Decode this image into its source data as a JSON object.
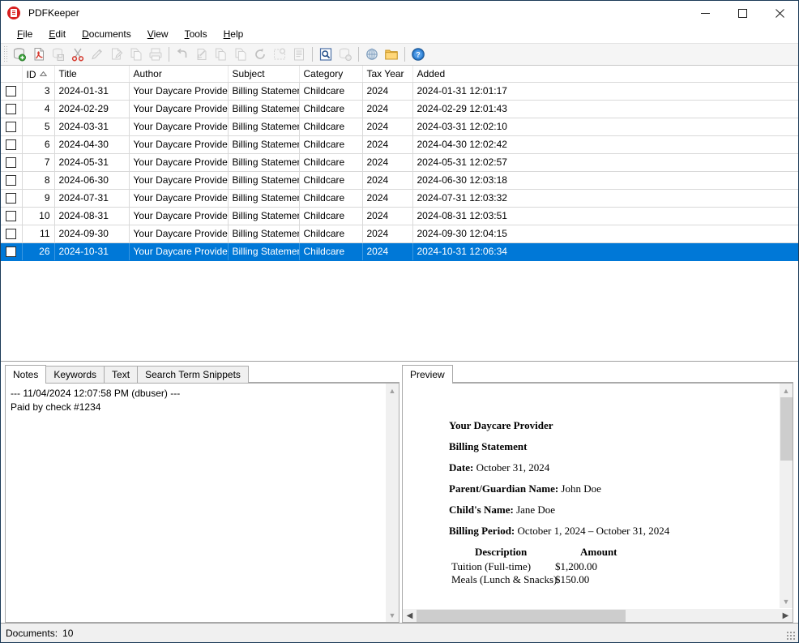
{
  "window": {
    "title": "PDFKeeper",
    "icon": "pdf-document-icon",
    "minimize_label": "Minimize",
    "maximize_label": "Maximize",
    "close_label": "Close"
  },
  "menubar": {
    "items": [
      {
        "label": "File",
        "mnemonic": "F"
      },
      {
        "label": "Edit",
        "mnemonic": "E"
      },
      {
        "label": "Documents",
        "mnemonic": "D"
      },
      {
        "label": "View",
        "mnemonic": "V"
      },
      {
        "label": "Tools",
        "mnemonic": "T"
      },
      {
        "label": "Help",
        "mnemonic": "H"
      }
    ]
  },
  "toolbar": {
    "buttons": [
      {
        "name": "add-document-button",
        "icon": "database-add-icon",
        "enabled": true
      },
      {
        "name": "open-pdf-button",
        "icon": "pdf-file-icon",
        "enabled": true
      },
      {
        "name": "save-document-button",
        "icon": "database-save-icon",
        "enabled": false
      },
      {
        "name": "cut-button",
        "icon": "scissors-icon",
        "enabled": true
      },
      {
        "name": "edit-button",
        "icon": "pencil-icon",
        "enabled": false
      },
      {
        "name": "notes-button",
        "icon": "note-edit-icon",
        "enabled": false
      },
      {
        "name": "copy-button",
        "icon": "copy-icon",
        "enabled": false
      },
      {
        "name": "print-button",
        "icon": "printer-icon",
        "enabled": false
      },
      {
        "name": "separator-1",
        "icon": "separator",
        "enabled": false
      },
      {
        "name": "undo-button",
        "icon": "undo-arrow-icon",
        "enabled": false
      },
      {
        "name": "redo-button",
        "icon": "redo-page-icon",
        "enabled": false
      },
      {
        "name": "duplicate-button",
        "icon": "pages-icon",
        "enabled": false
      },
      {
        "name": "paste-button",
        "icon": "page-copy-icon",
        "enabled": false
      },
      {
        "name": "refresh-button",
        "icon": "circular-arrow-icon",
        "enabled": false
      },
      {
        "name": "new-window-button",
        "icon": "window-add-icon",
        "enabled": false
      },
      {
        "name": "text-view-button",
        "icon": "text-page-icon",
        "enabled": false
      },
      {
        "name": "separator-2",
        "icon": "separator",
        "enabled": false
      },
      {
        "name": "search-button",
        "icon": "magnifier-page-icon",
        "enabled": true
      },
      {
        "name": "delete-database-button",
        "icon": "database-delete-icon",
        "enabled": false
      },
      {
        "name": "separator-3",
        "icon": "separator",
        "enabled": false
      },
      {
        "name": "settings-button",
        "icon": "gear-globe-icon",
        "enabled": true
      },
      {
        "name": "open-folder-button",
        "icon": "folder-icon",
        "enabled": true
      },
      {
        "name": "separator-4",
        "icon": "separator",
        "enabled": false
      },
      {
        "name": "help-button",
        "icon": "help-question-icon",
        "enabled": true
      }
    ]
  },
  "documents": {
    "columns": [
      "",
      "ID",
      "Title",
      "Author",
      "Subject",
      "Category",
      "Tax Year",
      "Added"
    ],
    "sort_column": "ID",
    "sort_direction": "ascending",
    "rows": [
      {
        "checked": false,
        "id": "3",
        "title": "2024-01-31",
        "author": "Your Daycare Provider",
        "subject": "Billing Statement",
        "category": "Childcare",
        "tax_year": "2024",
        "added": "2024-01-31 12:01:17",
        "selected": false
      },
      {
        "checked": false,
        "id": "4",
        "title": "2024-02-29",
        "author": "Your Daycare Provider",
        "subject": "Billing Statement",
        "category": "Childcare",
        "tax_year": "2024",
        "added": "2024-02-29 12:01:43",
        "selected": false
      },
      {
        "checked": false,
        "id": "5",
        "title": "2024-03-31",
        "author": "Your Daycare Provider",
        "subject": "Billing Statement",
        "category": "Childcare",
        "tax_year": "2024",
        "added": "2024-03-31 12:02:10",
        "selected": false
      },
      {
        "checked": false,
        "id": "6",
        "title": "2024-04-30",
        "author": "Your Daycare Provider",
        "subject": "Billing Statement",
        "category": "Childcare",
        "tax_year": "2024",
        "added": "2024-04-30 12:02:42",
        "selected": false
      },
      {
        "checked": false,
        "id": "7",
        "title": "2024-05-31",
        "author": "Your Daycare Provider",
        "subject": "Billing Statement",
        "category": "Childcare",
        "tax_year": "2024",
        "added": "2024-05-31 12:02:57",
        "selected": false
      },
      {
        "checked": false,
        "id": "8",
        "title": "2024-06-30",
        "author": "Your Daycare Provider",
        "subject": "Billing Statement",
        "category": "Childcare",
        "tax_year": "2024",
        "added": "2024-06-30 12:03:18",
        "selected": false
      },
      {
        "checked": false,
        "id": "9",
        "title": "2024-07-31",
        "author": "Your Daycare Provider",
        "subject": "Billing Statement",
        "category": "Childcare",
        "tax_year": "2024",
        "added": "2024-07-31 12:03:32",
        "selected": false
      },
      {
        "checked": false,
        "id": "10",
        "title": "2024-08-31",
        "author": "Your Daycare Provider",
        "subject": "Billing Statement",
        "category": "Childcare",
        "tax_year": "2024",
        "added": "2024-08-31 12:03:51",
        "selected": false
      },
      {
        "checked": false,
        "id": "11",
        "title": "2024-09-30",
        "author": "Your Daycare Provider",
        "subject": "Billing Statement",
        "category": "Childcare",
        "tax_year": "2024",
        "added": "2024-09-30 12:04:15",
        "selected": false
      },
      {
        "checked": false,
        "id": "26",
        "title": "2024-10-31",
        "author": "Your Daycare Provider",
        "subject": "Billing Statement",
        "category": "Childcare",
        "tax_year": "2024",
        "added": "2024-10-31 12:06:34",
        "selected": true
      }
    ]
  },
  "notes_panel": {
    "tabs": [
      {
        "label": "Notes",
        "active": true
      },
      {
        "label": "Keywords",
        "active": false
      },
      {
        "label": "Text",
        "active": false
      },
      {
        "label": "Search Term Snippets",
        "active": false
      }
    ],
    "content": "--- 11/04/2024 12:07:58 PM (dbuser) ---\nPaid by check #1234"
  },
  "preview_panel": {
    "tabs": [
      {
        "label": "Preview",
        "active": true
      }
    ],
    "document": {
      "provider": "Your Daycare Provider",
      "doc_type": "Billing Statement",
      "date_label": "Date:",
      "date_value": "October 31, 2024",
      "parent_label": "Parent/Guardian Name:",
      "parent_value": "John Doe",
      "child_label": "Child's Name:",
      "child_value": "Jane Doe",
      "period_label": "Billing Period:",
      "period_value": "October 1, 2024 – October 31, 2024",
      "table_headers": {
        "description": "Description",
        "amount": "Amount"
      },
      "line_items": [
        {
          "description": "Tuition (Full-time)",
          "amount": "$1,200.00"
        },
        {
          "description": "Meals (Lunch & Snacks)",
          "amount": "$150.00"
        }
      ]
    }
  },
  "statusbar": {
    "label": "Documents:",
    "count": "10"
  },
  "colors": {
    "selection_blue": "#0078d7",
    "window_border": "#1b3a57",
    "toolbar_bg": "#f5f5f5",
    "statusbar_bg": "#f0f0f0",
    "app_icon_red": "#d82020"
  }
}
